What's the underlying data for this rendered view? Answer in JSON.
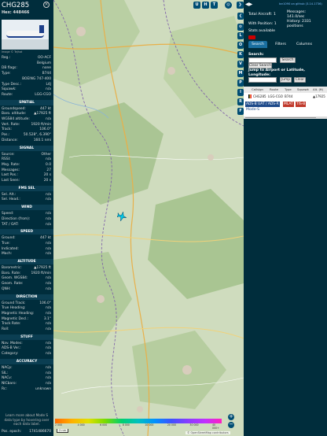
{
  "aircraft": {
    "callsign": "CHG285",
    "hex_label": "Hex: 448466",
    "image_credit": "Image © Tejhat",
    "details": [
      {
        "k": "Reg.:",
        "v": "OO-ACF"
      },
      {
        "k": "",
        "v": "Belgium"
      },
      {
        "k": "DB flags:",
        "v": "none"
      },
      {
        "k": "Type:",
        "v": "B744"
      },
      {
        "k": "",
        "v": "BOEING 747-400"
      },
      {
        "k": "Type Desc.:",
        "v": "L4J"
      },
      {
        "k": "Squawk:",
        "v": "n/a"
      },
      {
        "k": "Route:",
        "v": "LGG-CGO"
      }
    ]
  },
  "sections": {
    "spatial": {
      "title": "SPATIAL",
      "rows": [
        {
          "k": "Groundspeed:",
          "v": "447 kt"
        },
        {
          "k": "Baro. altitude:",
          "v": "▲17925 ft"
        },
        {
          "k": "WGS84 altitude:",
          "v": "n/a"
        },
        {
          "k": "Vert. Rate:",
          "v": "1920 ft/min"
        },
        {
          "k": "Track:",
          "v": "106.0°"
        },
        {
          "k": "Pos.:",
          "v": "50.528°, 6.390°"
        },
        {
          "k": "Distance:",
          "v": "160.1 nmi"
        }
      ]
    },
    "signal": {
      "title": "SIGNAL",
      "rows": [
        {
          "k": "Source:",
          "v": "Other"
        },
        {
          "k": "RSSI:",
          "v": "n/a"
        },
        {
          "k": "Msg. Rate:",
          "v": "0.0"
        },
        {
          "k": "Messages:",
          "v": "27"
        },
        {
          "k": "Last Pos.:",
          "v": "20 s"
        },
        {
          "k": "Last Seen:",
          "v": "20 s"
        }
      ]
    },
    "fms": {
      "title": "FMS SEL",
      "rows": [
        {
          "k": "Sel. Alt.:",
          "v": "n/a"
        },
        {
          "k": "Sel. Head.:",
          "v": "n/a"
        }
      ]
    },
    "wind": {
      "title": "WIND",
      "rows": [
        {
          "k": "Speed:",
          "v": "n/a"
        },
        {
          "k": "Direction (from):",
          "v": "n/a"
        },
        {
          "k": "TAT / OAT:",
          "v": "n/a"
        }
      ]
    },
    "speed": {
      "title": "SPEED",
      "rows": [
        {
          "k": "Ground:",
          "v": "447 kt"
        },
        {
          "k": "True:",
          "v": "n/a"
        },
        {
          "k": "Indicated:",
          "v": "n/a"
        },
        {
          "k": "Mach:",
          "v": "n/a"
        }
      ]
    },
    "altitude": {
      "title": "ALTITUDE",
      "rows": [
        {
          "k": "Barometric:",
          "v": "▲17925 ft"
        },
        {
          "k": "Baro. Rate:",
          "v": "1920 ft/min"
        },
        {
          "k": "Geom. WGS84:",
          "v": "n/a"
        },
        {
          "k": "Geom. Rate:",
          "v": "n/a"
        },
        {
          "k": "QNH:",
          "v": "n/a"
        }
      ]
    },
    "direction": {
      "title": "DIRECTION",
      "rows": [
        {
          "k": "Ground Track:",
          "v": "106.0°"
        },
        {
          "k": "True Heading:",
          "v": "n/a"
        },
        {
          "k": "Magnetic Heading:",
          "v": "n/a"
        },
        {
          "k": "Magnetic Decl.:",
          "v": "3.1°"
        },
        {
          "k": "Track Rate:",
          "v": "n/a"
        },
        {
          "k": "Roll:",
          "v": "n/a"
        }
      ]
    },
    "stuff": {
      "title": "STUFF",
      "rows": [
        {
          "k": "Nav. Modes:",
          "v": "n/a"
        },
        {
          "k": "ADS-B Ver.:",
          "v": "n/a"
        },
        {
          "k": "Category:",
          "v": "n/a"
        }
      ]
    },
    "accuracy": {
      "title": "ACCURACY",
      "rows": [
        {
          "k": "NACp:",
          "v": "n/a"
        },
        {
          "k": "SIL:",
          "v": "n/a"
        },
        {
          "k": "NACv:",
          "v": "n/a"
        },
        {
          "k": "NICbaro:",
          "v": "n/a"
        },
        {
          "k": "Rc:",
          "v": "unknown"
        }
      ]
    },
    "note": "Learn more about Mode S data type by hovering over each data label.",
    "pos_epoch": {
      "k": "Pos. epoch:",
      "v": "1741486670"
    }
  },
  "map": {
    "top_buttons": [
      "U",
      "H",
      "T"
    ],
    "side_buttons": [
      "L",
      "O",
      "K",
      "V",
      "M",
      "P",
      "I",
      "R",
      "F"
    ],
    "zoom_in": "+",
    "zoom_out": "−",
    "scale": "2 nm",
    "attribution": "© OpenStreetMap contributors",
    "altitude_legend": [
      "2 000",
      "4 000",
      "6 000",
      "8 000",
      "10 000",
      "20 000",
      "30 000",
      "40 000+"
    ]
  },
  "right": {
    "nav_arrows": "◀▶",
    "version": "tar1090 on github (3.14.1736)",
    "total_aircraft": "Total Aircraft: 1",
    "messages": "Messages:",
    "messages_rate": "141.0/sec",
    "with_position": "With Position: 1",
    "history": "History: 2331",
    "history_unit": "positions",
    "stats_available": "Stats available",
    "tabs": [
      "Search",
      "Filters",
      "Columns"
    ],
    "search_label": "Search:",
    "search_button": "Search",
    "clear_search_button": "Clear Search",
    "jump_label": "Jump to Airport or Latitude, Longitude:",
    "jump_button": "Jump",
    "clear_button": "Clear",
    "table_headers": [
      "Callsign",
      "Route",
      "Type",
      "Squawk",
      "Alt. (ft)"
    ],
    "table_row": [
      "CHG285",
      "LGG-CGO",
      "B744",
      "",
      "▲17925"
    ],
    "source_chips": [
      {
        "label": "ADS-B",
        "color": "#1e4a8a"
      },
      {
        "label": "UAT / ADS-R",
        "color": "#1e4a8a"
      },
      {
        "label": "MLAT",
        "color": "#c0392b"
      },
      {
        "label": "TIS-B",
        "color": "#c0392b"
      }
    ],
    "modes_label": "Mode-S"
  }
}
